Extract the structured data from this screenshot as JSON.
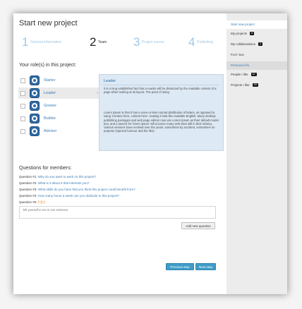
{
  "page": {
    "title": "Start new project"
  },
  "steps": [
    {
      "num": "1",
      "label": "General information"
    },
    {
      "num": "2",
      "label": "Team"
    },
    {
      "num": "3",
      "label": "Project survey"
    },
    {
      "num": "4",
      "label": "Publishing"
    }
  ],
  "active_step": 2,
  "roles": {
    "title": "Your role(s) in this project:",
    "items": [
      {
        "name": "Starter",
        "icon": "starter-icon"
      },
      {
        "name": "Leader",
        "icon": "leader-icon"
      },
      {
        "name": "Grower",
        "icon": "grower-icon"
      },
      {
        "name": "Builder",
        "icon": "builder-icon"
      },
      {
        "name": "Adviser",
        "icon": "adviser-icon"
      }
    ],
    "selected": "Leader"
  },
  "info_box": {
    "title": "Leader",
    "paragraph1": "It is a long established fact that a reader will be distracted by the readable content of a page when looking at its layout. The point of using",
    "paragraph2": "Lorem Ipsum is that it has a more-or-less normal distribution of letters, as opposed to using 'Content here, content here', making it look like readable English. Many desktop publishing packages and web page editors now use Lorem Ipsum as their default model text, and a search for 'lorem ipsum' will uncover many web sites still in their infancy. Various versions have evolved over the years, sometimes by accident, sometimes on purpose (injected humour and the like)."
  },
  "questions": {
    "title": "Questions for members:",
    "items": [
      {
        "label": "Question #1:",
        "text": "Why do you want to work on this project?"
      },
      {
        "label": "Question #2:",
        "text": "What is it about it that interests you?"
      },
      {
        "label": "Question #3:",
        "text": "What skills do you have that you think this project could benefit from?"
      },
      {
        "label": "Question #4:",
        "text": "How many hours a week can you dedicate to this project?"
      },
      {
        "label": "Question #5:",
        "text": "[?][?]"
      }
    ],
    "input_placeholder": "Tell yourself to me in one sentence",
    "add_button": "Add new question"
  },
  "nav_buttons": {
    "previous": "Previous step",
    "next": "Next step"
  },
  "sidebar": {
    "items": [
      {
        "label": "Start new project",
        "badge": ""
      },
      {
        "label": "My projects",
        "badge": "5"
      },
      {
        "label": "My collaborations",
        "badge": "2"
      },
      {
        "label": "FLO- box",
        "badge": ""
      },
      {
        "label": "Personal info",
        "badge": ""
      },
      {
        "label": "People I like",
        "badge": "12"
      },
      {
        "label": "Projects I like",
        "badge": "29"
      }
    ]
  },
  "colors": {
    "accent": "#3a7cb5",
    "step_inactive": "#9ec7e6",
    "button_blue": "#3f9dc7",
    "info_bg": "#dde9f4",
    "pending": "#f08a24"
  }
}
